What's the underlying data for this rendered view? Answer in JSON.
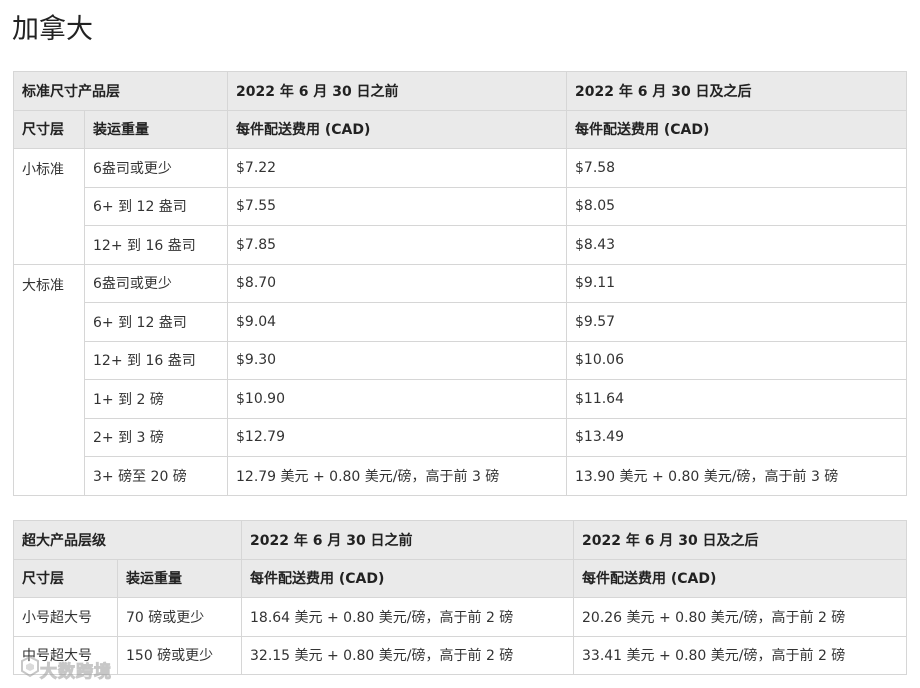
{
  "page": {
    "title": "加拿大"
  },
  "table_standard": {
    "header1": [
      "标准尺寸产品层",
      "2022 年 6 月 30 日之前",
      "2022 年 6 月 30 日及之后"
    ],
    "header2": [
      "尺寸层",
      "装运重量",
      "每件配送费用 (CAD)",
      "每件配送费用 (CAD)"
    ],
    "groups": [
      {
        "tier": "小标准",
        "rows": [
          {
            "weight": "6盎司或更少",
            "before": "$7.22",
            "after": "$7.58"
          },
          {
            "weight": "6+ 到 12 盎司",
            "before": "$7.55",
            "after": "$8.05"
          },
          {
            "weight": "12+ 到 16 盎司",
            "before": "$7.85",
            "after": "$8.43"
          }
        ]
      },
      {
        "tier": "大标准",
        "rows": [
          {
            "weight": "6盎司或更少",
            "before": "$8.70",
            "after": "$9.11"
          },
          {
            "weight": "6+ 到 12 盎司",
            "before": "$9.04",
            "after": "$9.57"
          },
          {
            "weight": "12+ 到 16 盎司",
            "before": "$9.30",
            "after": "$10.06"
          },
          {
            "weight": "1+ 到 2 磅",
            "before": "$10.90",
            "after": "$11.64"
          },
          {
            "weight": "2+ 到 3 磅",
            "before": "$12.79",
            "after": "$13.49"
          },
          {
            "weight": "3+ 磅至 20 磅",
            "before": "12.79 美元 + 0.80 美元/磅，高于前 3 磅",
            "after": "13.90 美元 + 0.80 美元/磅，高于前 3 磅"
          }
        ]
      }
    ]
  },
  "table_oversize": {
    "header1": [
      "超大产品层级",
      "2022 年 6 月 30 日之前",
      "2022 年 6 月 30 日及之后"
    ],
    "header2": [
      "尺寸层",
      "装运重量",
      "每件配送费用 (CAD)",
      "每件配送费用 (CAD)"
    ],
    "rows": [
      {
        "tier": "小号超大号",
        "weight": "70 磅或更少",
        "before": "18.64 美元 + 0.80 美元/磅，高于前 2 磅",
        "after": "20.26 美元 + 0.80 美元/磅，高于前 2 磅"
      },
      {
        "tier": "中号超大号",
        "weight": "150 磅或更少",
        "before": "32.15 美元 + 0.80 美元/磅，高于前 2 磅",
        "after": "33.41 美元 + 0.80 美元/磅，高于前 2 磅"
      }
    ]
  },
  "watermark": {
    "text": "大数跨境"
  }
}
